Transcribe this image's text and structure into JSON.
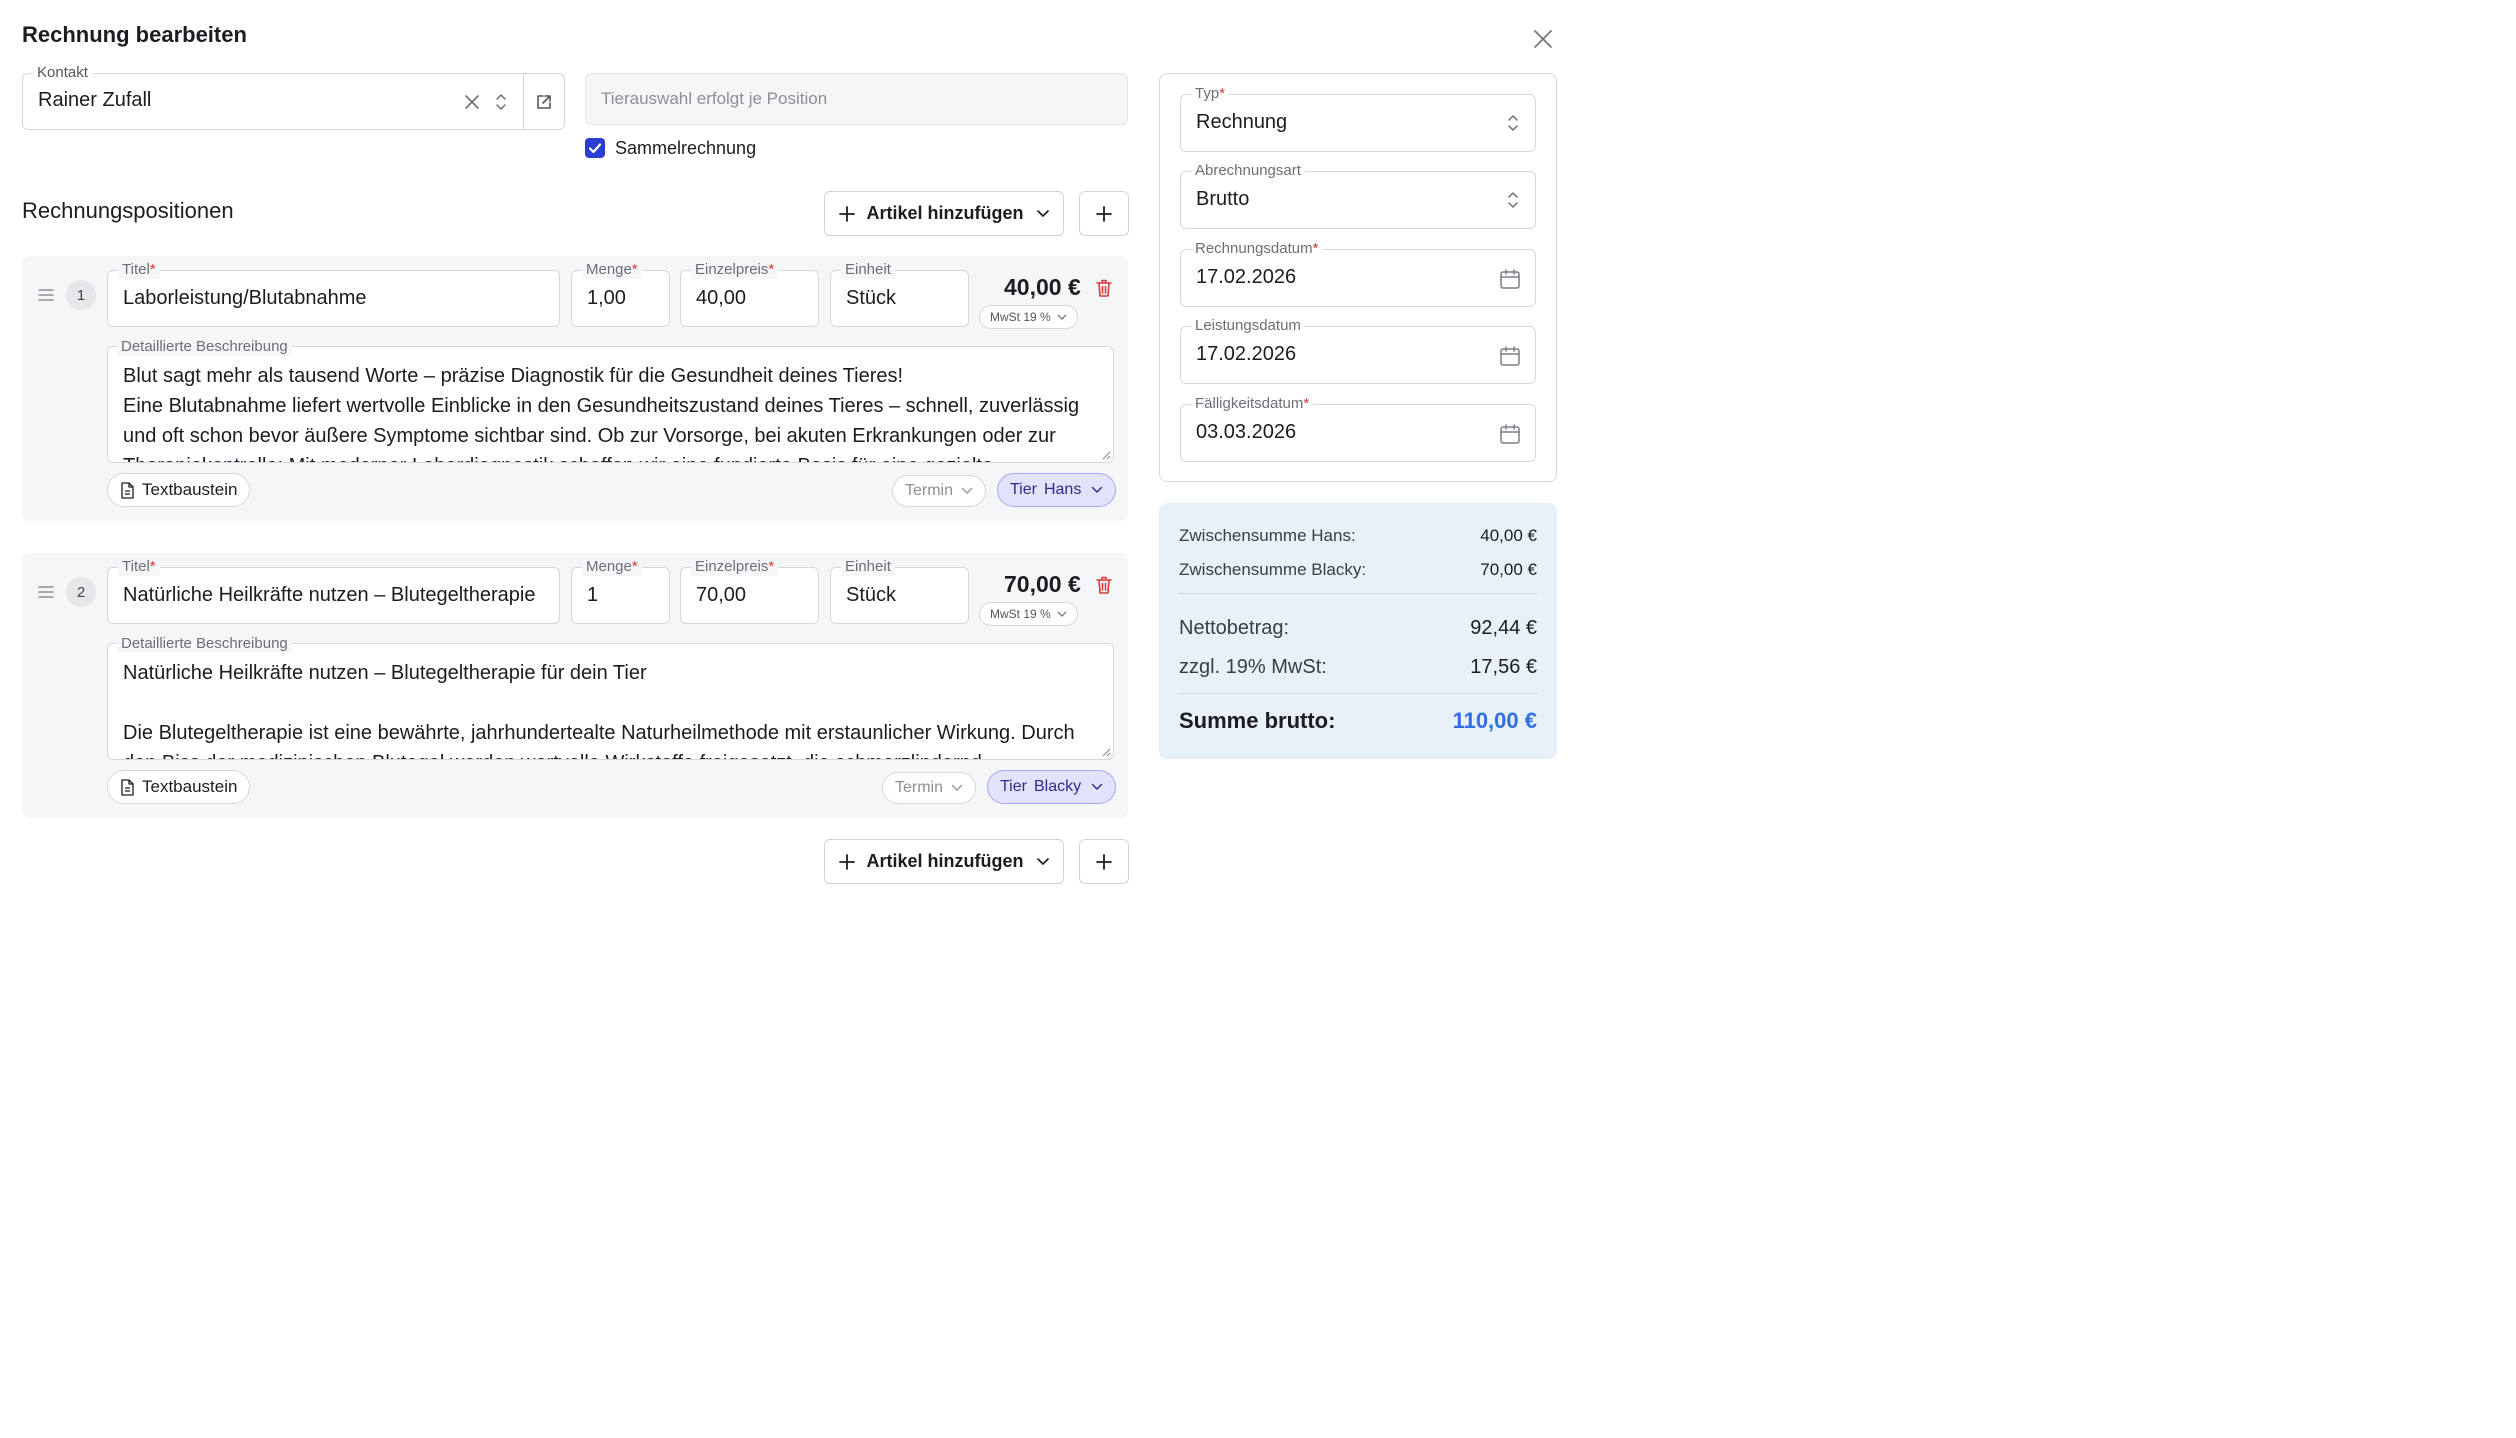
{
  "dialog": {
    "title": "Rechnung bearbeiten"
  },
  "contact": {
    "label": "Kontakt",
    "value": "Rainer Zufall"
  },
  "tier_select": {
    "placeholder": "Tierauswahl erfolgt je Position"
  },
  "sammelrechnung": {
    "label": "Sammelrechnung",
    "checked": true
  },
  "positions_section": {
    "title": "Rechnungspositionen",
    "add_article_label": "Artikel hinzufügen"
  },
  "labels": {
    "titel": "Titel",
    "menge": "Menge",
    "einzelpreis": "Einzelpreis",
    "einheit": "Einheit",
    "beschreibung": "Detaillierte Beschreibung",
    "textbaustein": "Textbaustein",
    "termin": "Termin",
    "required_mark": "*"
  },
  "positions": [
    {
      "number": "1",
      "titel": "Laborleistung/Blutabnahme",
      "menge": "1,00",
      "einzelpreis": "40,00",
      "einheit": "Stück",
      "total": "40,00 €",
      "mwst": "MwSt  19 %",
      "description_lines": [
        "Blut sagt mehr als tausend Worte – präzise Diagnostik für die Gesundheit deines Tieres!",
        "Eine Blutabnahme liefert wertvolle Einblicke in den Gesundheitszustand deines Tieres – schnell, zuverlässig",
        "und oft schon bevor äußere Symptome sichtbar sind. Ob zur Vorsorge, bei akuten Erkrankungen oder zur",
        "Therapiekontrolle: Mit moderner Labordiagnostik schaffen wir eine fundierte Basis für eine gezielte"
      ],
      "tier_prefix": "Tier",
      "tier_name": "Hans"
    },
    {
      "number": "2",
      "titel": "Natürliche Heilkräfte nutzen – Blutegeltherapie",
      "menge": "1",
      "einzelpreis": "70,00",
      "einheit": "Stück",
      "total": "70,00 €",
      "mwst": "MwSt  19 %",
      "description_lines": [
        "Natürliche Heilkräfte nutzen – Blutegeltherapie für dein Tier",
        "",
        "Die Blutegeltherapie ist eine bewährte, jahrhundertealte Naturheilmethode mit erstaunlicher Wirkung. Durch",
        "den Biss der medizinischen Blutegel werden wertvolle Wirkstoffe freigesetzt, die schmerzlindernd"
      ],
      "tier_prefix": "Tier",
      "tier_name": "Blacky"
    }
  ],
  "meta": {
    "typ": {
      "label": "Typ",
      "value": "Rechnung"
    },
    "abrechnungsart": {
      "label": "Abrechnungsart",
      "value": "Brutto"
    },
    "rechnungsdatum": {
      "label": "Rechnungsdatum",
      "value": "17.02.2026"
    },
    "leistungsdatum": {
      "label": "Leistungsdatum",
      "value": "17.02.2026"
    },
    "faelligkeitsdatum": {
      "label": "Fälligkeitsdatum",
      "value": "03.03.2026"
    }
  },
  "summary": {
    "subtotals": [
      {
        "label": "Zwischensumme Hans:",
        "value": "40,00 €"
      },
      {
        "label": "Zwischensumme Blacky:",
        "value": "70,00 €"
      }
    ],
    "netto_label": "Nettobetrag:",
    "netto_value": "92,44 €",
    "mwst_label": "zzgl. 19% MwSt:",
    "mwst_value": "17,56 €",
    "brutto_label": "Summe brutto:",
    "brutto_value": "110,00 €"
  },
  "colors": {
    "accent": "#2f6fe0",
    "danger": "#d63b3b",
    "checkbox": "#2a3fd1",
    "tier_pill": "#e3e2fb"
  },
  "icons": [
    "close-icon",
    "clear-icon",
    "updown-icon",
    "external-link-icon",
    "plus-icon",
    "chevron-down-icon",
    "drag-handle-icon",
    "trash-icon",
    "document-icon",
    "calendar-icon",
    "checkbox-checked-icon"
  ]
}
